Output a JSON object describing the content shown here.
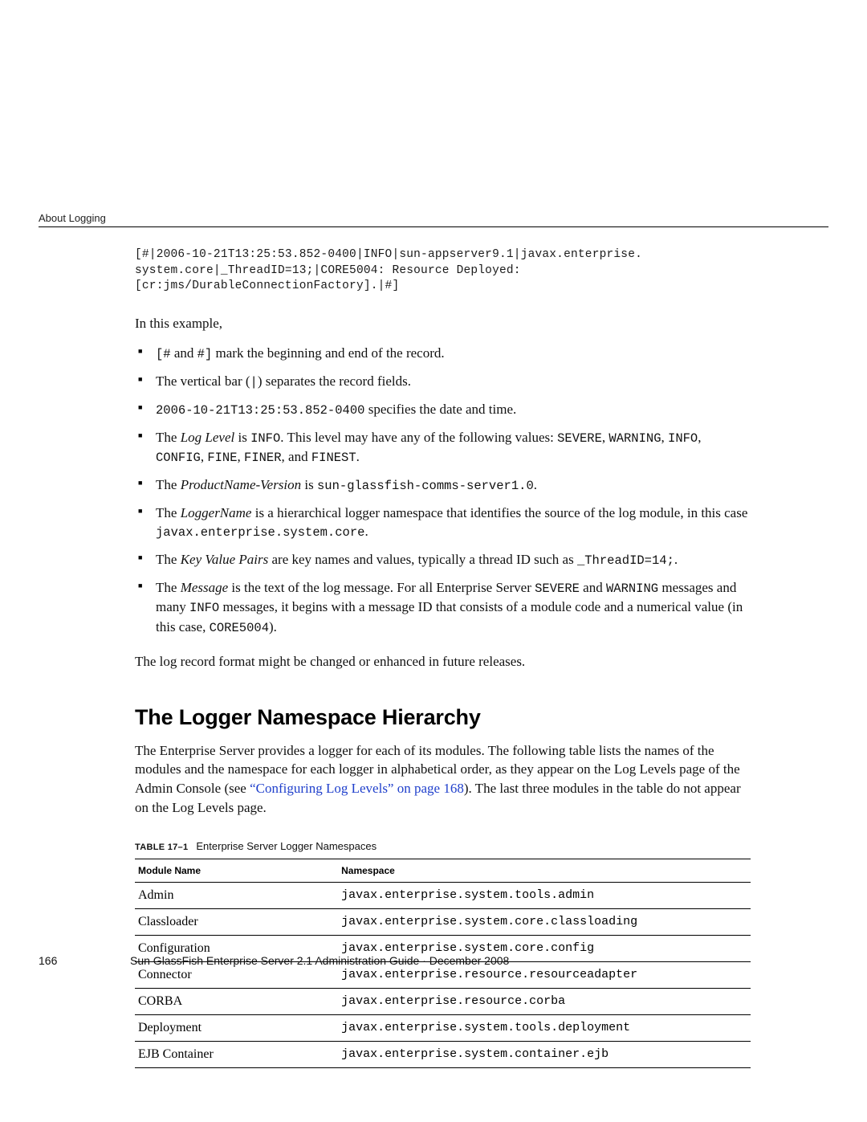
{
  "runningHead": "About Logging",
  "code": "[#|2006-10-21T13:25:53.852-0400|INFO|sun-appserver9.1|javax.enterprise.\nsystem.core|_ThreadID=13;|CORE5004: Resource Deployed:\n[cr:jms/DurableConnectionFactory].|#]",
  "intro": "In this example,",
  "bullets": {
    "b1a": "[#",
    "b1b": " and ",
    "b1c": "#]",
    "b1d": " mark the beginning and end of the record.",
    "b2a": "The vertical bar (",
    "b2b": "|",
    "b2c": ") separates the record fields.",
    "b3a": "2006-10-21T13:25:53.852-0400",
    "b3b": " specifies the date and time.",
    "b4a": "The ",
    "b4b": "Log Level",
    "b4c": " is ",
    "b4d": "INFO",
    "b4e": ". This level may have any of the following values: ",
    "b4f": "SEVERE",
    "b4g": ", ",
    "b4h": "WARNING",
    "b4i": ", ",
    "b4j": "INFO",
    "b4k": ", ",
    "b4l": "CONFIG",
    "b4m": ", ",
    "b4n": "FINE",
    "b4o": ", ",
    "b4p": "FINER",
    "b4q": ", and ",
    "b4r": "FINEST",
    "b4s": ".",
    "b5a": "The ",
    "b5b": "ProductName-Version",
    "b5c": " is ",
    "b5d": "sun-glassfish-comms-server1.0",
    "b5e": ".",
    "b6a": "The ",
    "b6b": "LoggerName",
    "b6c": " is a hierarchical logger namespace that identifies the source of the log module, in this case ",
    "b6d": "javax.enterprise.system.core",
    "b6e": ".",
    "b7a": "The ",
    "b7b": "Key Value Pairs",
    "b7c": " are key names and values, typically a thread ID such as ",
    "b7d": "_ThreadID=14;",
    "b7e": ".",
    "b8a": "The ",
    "b8b": "Message",
    "b8c": " is the text of the log message. For all Enterprise Server ",
    "b8d": "SEVERE",
    "b8e": " and ",
    "b8f": "WARNING",
    "b8g": " messages and many ",
    "b8h": "INFO",
    "b8i": " messages, it begins with a message ID that consists of a module code and a numerical value (in this case, ",
    "b8j": "CORE5004",
    "b8k": ")."
  },
  "afterList": "The log record format might be changed or enhanced in future releases.",
  "sectionTitle": "The Logger Namespace Hierarchy",
  "sectionPara": {
    "a": "The Enterprise Server provides a logger for each of its modules. The following table lists the names of the modules and the namespace for each logger in alphabetical order, as they appear on the Log Levels page of the Admin Console (see ",
    "link": "“Configuring Log Levels” on page 168",
    "b": "). The last three modules in the table do not appear on the Log Levels page."
  },
  "tableCaption": {
    "label": "TABLE 17–1",
    "text": "Enterprise Server Logger Namespaces"
  },
  "tableHeaders": {
    "col1": "Module Name",
    "col2": "Namespace"
  },
  "rows": [
    {
      "m": "Admin",
      "n": "javax.enterprise.system.tools.admin"
    },
    {
      "m": "Classloader",
      "n": "javax.enterprise.system.core.classloading"
    },
    {
      "m": "Configuration",
      "n": "javax.enterprise.system.core.config"
    },
    {
      "m": "Connector",
      "n": "javax.enterprise.resource.resourceadapter"
    },
    {
      "m": "CORBA",
      "n": "javax.enterprise.resource.corba"
    },
    {
      "m": "Deployment",
      "n": "javax.enterprise.system.tools.deployment"
    },
    {
      "m": "EJB Container",
      "n": "javax.enterprise.system.container.ejb"
    }
  ],
  "footer": {
    "pageNumber": "166",
    "text": "Sun GlassFish Enterprise Server 2.1 Administration Guide · December 2008"
  }
}
